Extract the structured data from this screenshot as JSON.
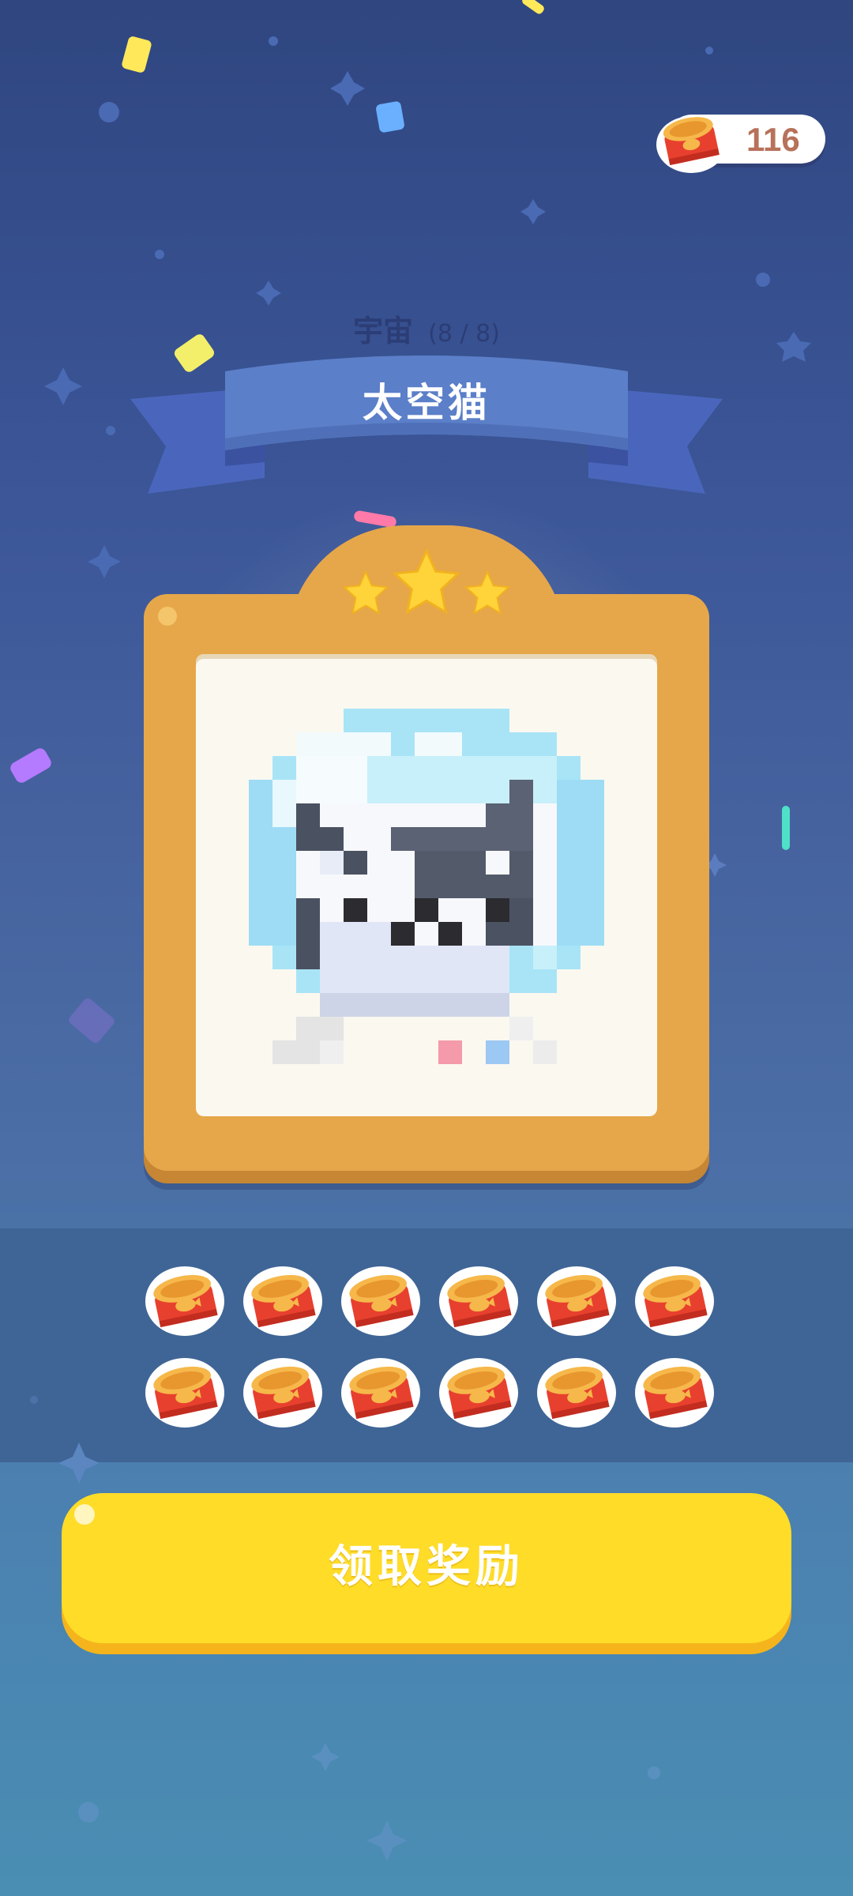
{
  "currency": {
    "count": "116",
    "icon": "fish-can-icon"
  },
  "collection": {
    "name": "宇宙",
    "progress": "(8 / 8)"
  },
  "item": {
    "title": "太空猫",
    "stars": 3
  },
  "rewards": {
    "item_icon": "fish-can-icon",
    "quantity_shown": 12
  },
  "actions": {
    "claim_label": "领取奖励"
  },
  "colors": {
    "frame": "#e6a74a",
    "button": "#ffdc28",
    "ribbon": "#5b7fc8",
    "star": "#ffd43a"
  }
}
